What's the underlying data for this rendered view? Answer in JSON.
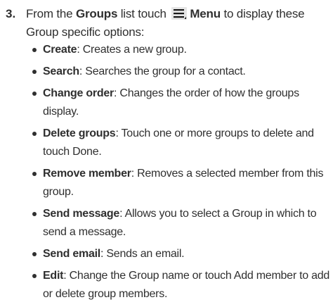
{
  "step": {
    "number": "3.",
    "text_before_groups": "From the ",
    "groups_label": "Groups",
    "text_after_groups": " list touch ",
    "menu_icon": "menu-icon",
    "menu_label": "Menu",
    "text_after_menu": " to display these Group specific options:"
  },
  "options": [
    {
      "term": "Create",
      "desc": ": Creates a new group."
    },
    {
      "term": "Search",
      "desc": ": Searches the group for a contact."
    },
    {
      "term": "Change order",
      "desc": ": Changes the order of how the groups display."
    },
    {
      "term": "Delete groups",
      "desc": ": Touch one or more groups to delete and touch Done."
    },
    {
      "term": "Remove member",
      "desc": ": Removes a selected member from this group."
    },
    {
      "term": "Send message",
      "desc": ": Allows you to select a Group in which to send a message."
    },
    {
      "term": "Send email",
      "desc": ": Sends an email."
    },
    {
      "term": "Edit",
      "desc": ": Change the Group name or touch Add member to add or delete group members."
    }
  ],
  "colors": {
    "text": "#2f2f2f",
    "icon_bg": "#e6e6e6"
  }
}
